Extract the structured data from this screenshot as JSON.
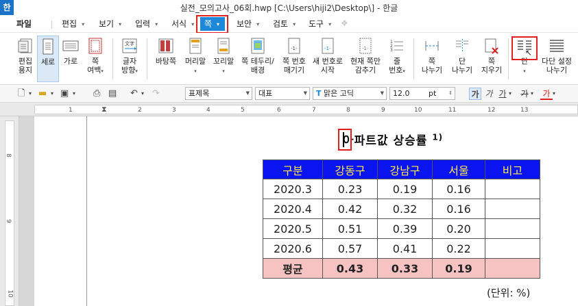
{
  "window": {
    "logo": "한",
    "title": "실전_모의고사_06회.hwp [C:\\Users\\hiji2\\Desktop\\] - 한글"
  },
  "menubar": {
    "items": [
      {
        "label": "파일"
      },
      {
        "label": "편집"
      },
      {
        "label": "보기"
      },
      {
        "label": "입력"
      },
      {
        "label": "서식"
      },
      {
        "label": "쪽"
      },
      {
        "label": "보안"
      },
      {
        "label": "검토"
      },
      {
        "label": "도구"
      }
    ],
    "active": "쪽"
  },
  "ribbon": {
    "buttons": [
      {
        "line1": "편집",
        "line2": "용지",
        "icon": "page-setup-icon"
      },
      {
        "line1": "세로",
        "line2": "",
        "icon": "portrait-icon",
        "selected": true
      },
      {
        "line1": "가로",
        "line2": "",
        "icon": "landscape-icon"
      },
      {
        "line1": "쪽",
        "line2": "여백",
        "icon": "margin-icon"
      },
      {
        "line1": "글자",
        "line2": "방향",
        "icon": "text-direction-icon"
      },
      {
        "line1": "바탕쪽",
        "line2": "",
        "icon": "master-page-icon"
      },
      {
        "line1": "머리말",
        "line2": "",
        "icon": "header-icon"
      },
      {
        "line1": "꼬리말",
        "line2": "",
        "icon": "footer-icon"
      },
      {
        "line1": "쪽 테두리/",
        "line2": "배경",
        "icon": "page-border-icon"
      },
      {
        "line1": "쪽 번호",
        "line2": "매기기",
        "icon": "page-number-icon"
      },
      {
        "line1": "새 번호로",
        "line2": "시작",
        "icon": "new-number-icon"
      },
      {
        "line1": "현재 쪽만",
        "line2": "감추기",
        "icon": "hide-icon"
      },
      {
        "line1": "줄",
        "line2": "번호",
        "icon": "line-number-icon"
      },
      {
        "line1": "쪽",
        "line2": "나누기",
        "icon": "page-break-icon"
      },
      {
        "line1": "단",
        "line2": "나누기",
        "icon": "column-break-icon"
      },
      {
        "line1": "쪽",
        "line2": "지우기",
        "icon": "page-delete-icon"
      },
      {
        "line1": "단",
        "line2": "",
        "icon": "columns-icon"
      },
      {
        "line1": "다단 설정",
        "line2": "나누기",
        "icon": "multi-column-icon"
      }
    ]
  },
  "toolbar": {
    "style": "표제목",
    "lang": "대표",
    "font": "맑은 고딕",
    "size": "12.0",
    "unit": "pt",
    "bold": "가",
    "italic": "가",
    "underline": "가",
    "strike": "가",
    "color": "가"
  },
  "ruler": {
    "h_ticks": [
      "1",
      "2",
      "3",
      "4",
      "5",
      "6",
      "7",
      "8",
      "9",
      "10",
      "11",
      "12",
      "13"
    ],
    "v_ticks": [
      "8",
      "9",
      "10",
      "11"
    ]
  },
  "document": {
    "title": "아파트값 상승률",
    "footnote": "1)",
    "table": {
      "headers": [
        "구분",
        "강동구",
        "강남구",
        "서울",
        "비고"
      ],
      "rows": [
        [
          "2020.3",
          "0.23",
          "0.19",
          "0.16",
          ""
        ],
        [
          "2020.4",
          "0.42",
          "0.32",
          "0.16",
          ""
        ],
        [
          "2020.5",
          "0.51",
          "0.39",
          "0.20",
          ""
        ],
        [
          "2020.6",
          "0.57",
          "0.41",
          "0.22",
          ""
        ]
      ],
      "avg_row": [
        "평균",
        "0.43",
        "0.33",
        "0.19",
        ""
      ]
    },
    "unit_note": "(단위: %)"
  },
  "colors": {
    "accent": "#1e88d8",
    "highlight_box": "#e02020",
    "table_header_bg": "#0a14f0",
    "table_header_text": "#ffe94a",
    "avg_row_bg": "#f7c2c2"
  }
}
